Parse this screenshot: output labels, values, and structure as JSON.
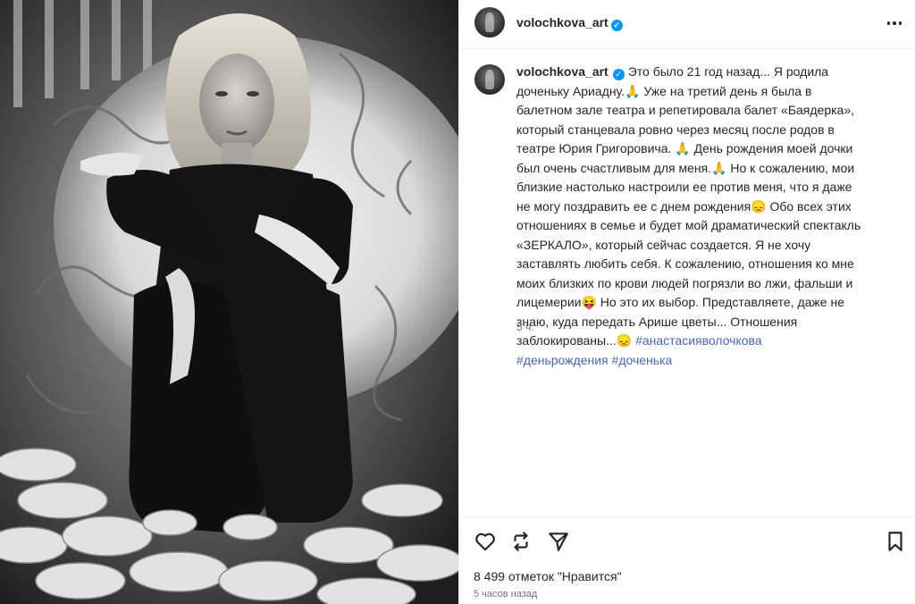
{
  "post": {
    "username": "volochkova_art",
    "verified": true,
    "more_icon": "more-horizontal-icon"
  },
  "caption": {
    "username": "volochkova_art",
    "text": "Это было 21 год назад... Я родила доченьку Ариадну.🙏 Уже на третий день я была в балетном зале театра и репетировала балет «Баядерка», который станцевала ровно через месяц после родов в театре Юрия Григоровича. 🙏 День рождения моей дочки был очень счастливым для меня.🙏 Но к сожалению, мои близкие настолько настроили ее против меня, что я даже не могу поздравить ее с днем рождения😞 Обо всех этих отношениях в семье и будет мой драматический спектакль «ЗЕРКАЛО», который сейчас создается. Я не хочу заставлять любить себя. К сожалению, отношения ко мне моих близких по крови людей погрязли во лжи, фальши и лицемерии😝 Но это их выбор. Представляете, даже не знаю, куда передать Арише цветы... Отношения заблокированы...😞 ",
    "hashtags": [
      "#анастасияволочкова",
      "#деньрождения",
      "#доченька"
    ],
    "time_ago": "5 ч."
  },
  "actions": {
    "like_icon": "heart-icon",
    "repost_icon": "repost-icon",
    "share_icon": "send-icon",
    "save_icon": "bookmark-icon"
  },
  "likes_text": "8 499 отметок \"Нравится\"",
  "posted_ago": "5 часов назад"
}
